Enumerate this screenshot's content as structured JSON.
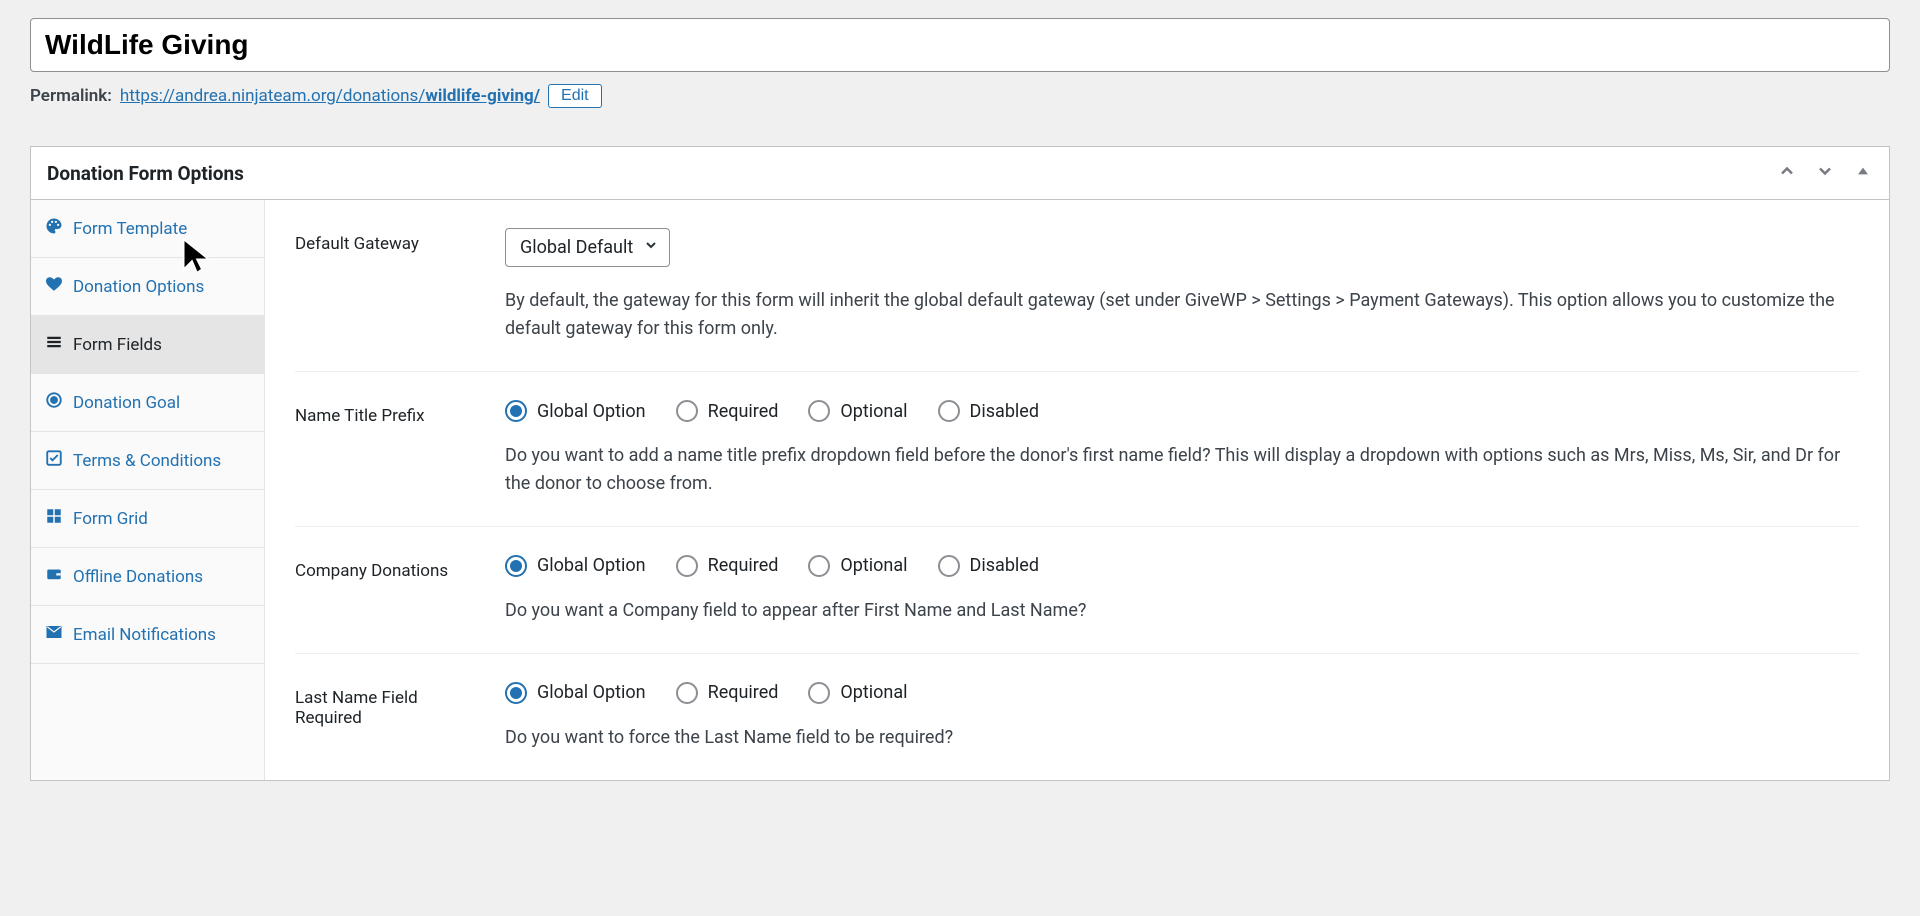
{
  "form": {
    "title": "WildLife Giving",
    "permalink_label": "Permalink:",
    "permalink_base": "https://andrea.ninjateam.org/donations/",
    "permalink_slug": "wildlife-giving/",
    "edit_label": "Edit"
  },
  "panel": {
    "title": "Donation Form Options"
  },
  "sidebar": {
    "items": [
      {
        "key": "form-template",
        "label": "Form Template",
        "active": false
      },
      {
        "key": "donation-options",
        "label": "Donation Options",
        "active": false
      },
      {
        "key": "form-fields",
        "label": "Form Fields",
        "active": true
      },
      {
        "key": "donation-goal",
        "label": "Donation Goal",
        "active": false
      },
      {
        "key": "terms-conditions",
        "label": "Terms & Conditions",
        "active": false
      },
      {
        "key": "form-grid",
        "label": "Form Grid",
        "active": false
      },
      {
        "key": "offline-donations",
        "label": "Offline Donations",
        "active": false
      },
      {
        "key": "email-notifications",
        "label": "Email Notifications",
        "active": false
      }
    ]
  },
  "fields": {
    "default_gateway": {
      "label": "Default Gateway",
      "value": "Global Default",
      "description": "By default, the gateway for this form will inherit the global default gateway (set under GiveWP > Settings > Payment Gateways). This option allows you to customize the default gateway for this form only."
    },
    "name_title_prefix": {
      "label": "Name Title Prefix",
      "options": [
        "Global Option",
        "Required",
        "Optional",
        "Disabled"
      ],
      "selected": "Global Option",
      "description": "Do you want to add a name title prefix dropdown field before the donor's first name field? This will display a dropdown with options such as Mrs, Miss, Ms, Sir, and Dr for the donor to choose from."
    },
    "company_donations": {
      "label": "Company Donations",
      "options": [
        "Global Option",
        "Required",
        "Optional",
        "Disabled"
      ],
      "selected": "Global Option",
      "description": "Do you want a Company field to appear after First Name and Last Name?"
    },
    "last_name_required": {
      "label": "Last Name Field Required",
      "options": [
        "Global Option",
        "Required",
        "Optional"
      ],
      "selected": "Global Option",
      "description": "Do you want to force the Last Name field to be required?"
    }
  }
}
